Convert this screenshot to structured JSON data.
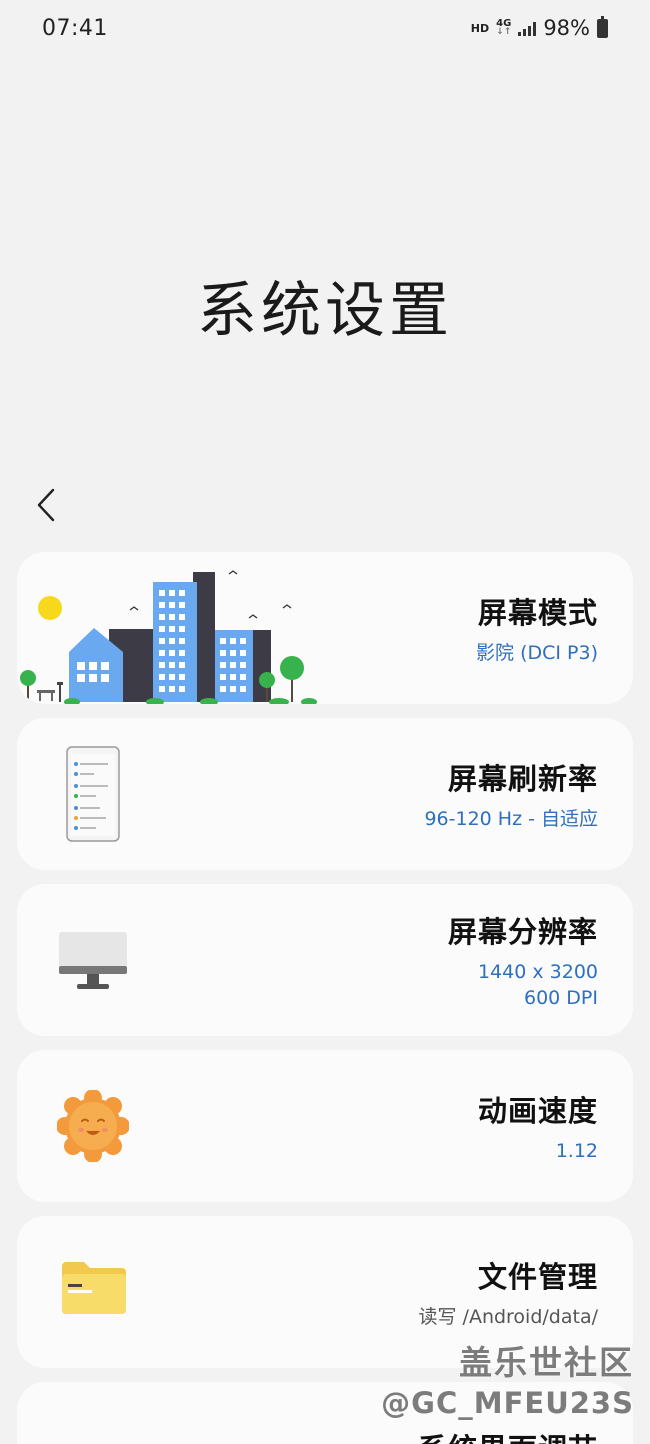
{
  "status_bar": {
    "time": "07:41",
    "hd": "HD",
    "network": "4G",
    "battery": "98%"
  },
  "page": {
    "title": "系统设置"
  },
  "cards": [
    {
      "title": "屏幕模式",
      "value": "影院 (DCI P3)",
      "icon": "city-illustration"
    },
    {
      "title": "屏幕刷新率",
      "value": "96-120 Hz - 自适应",
      "icon": "phone-icon"
    },
    {
      "title": "屏幕分辨率",
      "value": "1440 x 3200",
      "value2": "600 DPI",
      "icon": "monitor-icon"
    },
    {
      "title": "动画速度",
      "value": "1.12",
      "icon": "sun-icon"
    },
    {
      "title": "文件管理",
      "value": "读写 /Android/data/",
      "icon": "folder-icon"
    },
    {
      "title": "系统界面调节",
      "icon": "partial"
    }
  ],
  "watermark": {
    "line1": "盖乐世社区",
    "line2": "@GC_MFEU23S"
  },
  "colors": {
    "background": "#f2f2f2",
    "card": "#fbfbfb",
    "accent_blue": "#2f6fbf"
  }
}
